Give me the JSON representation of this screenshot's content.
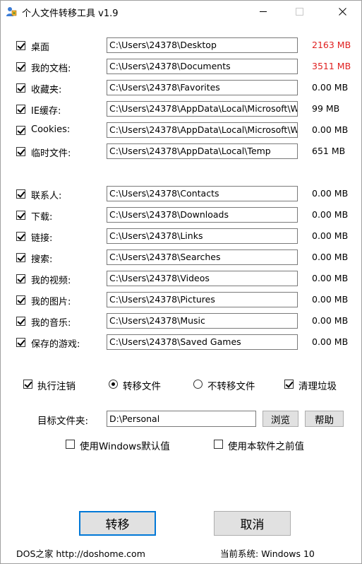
{
  "window": {
    "title": "个人文件转移工具 v1.9"
  },
  "folders_group1": [
    {
      "label": "桌面",
      "path": "C:\\Users\\24378\\Desktop",
      "size": "2163 MB",
      "checked": true,
      "highlight": true
    },
    {
      "label": "我的文档:",
      "path": "C:\\Users\\24378\\Documents",
      "size": "3511 MB",
      "checked": true,
      "highlight": true
    },
    {
      "label": "收藏夹:",
      "path": "C:\\Users\\24378\\Favorites",
      "size": "0.00 MB",
      "checked": true,
      "highlight": false
    },
    {
      "label": "IE缓存:",
      "path": "C:\\Users\\24378\\AppData\\Local\\Microsoft\\W",
      "size": "99 MB",
      "checked": true,
      "highlight": false
    },
    {
      "label": "Cookies:",
      "path": "C:\\Users\\24378\\AppData\\Local\\Microsoft\\W",
      "size": "0.00 MB",
      "checked": true,
      "highlight": false
    },
    {
      "label": "临时文件:",
      "path": "C:\\Users\\24378\\AppData\\Local\\Temp",
      "size": "651 MB",
      "checked": true,
      "highlight": false
    }
  ],
  "folders_group2": [
    {
      "label": "联系人:",
      "path": "C:\\Users\\24378\\Contacts",
      "size": "0.00 MB",
      "checked": true,
      "highlight": false
    },
    {
      "label": "下载:",
      "path": "C:\\Users\\24378\\Downloads",
      "size": "0.00 MB",
      "checked": true,
      "highlight": false
    },
    {
      "label": "链接:",
      "path": "C:\\Users\\24378\\Links",
      "size": "0.00 MB",
      "checked": true,
      "highlight": false
    },
    {
      "label": "搜索:",
      "path": "C:\\Users\\24378\\Searches",
      "size": "0.00 MB",
      "checked": true,
      "highlight": false
    },
    {
      "label": "我的视频:",
      "path": "C:\\Users\\24378\\Videos",
      "size": "0.00 MB",
      "checked": true,
      "highlight": false
    },
    {
      "label": "我的图片:",
      "path": "C:\\Users\\24378\\Pictures",
      "size": "0.00 MB",
      "checked": true,
      "highlight": false
    },
    {
      "label": "我的音乐:",
      "path": "C:\\Users\\24378\\Music",
      "size": "0.00 MB",
      "checked": true,
      "highlight": false
    },
    {
      "label": "保存的游戏:",
      "path": "C:\\Users\\24378\\Saved Games",
      "size": "0.00 MB",
      "checked": true,
      "highlight": false
    }
  ],
  "options": {
    "logoff": {
      "label": "执行注销",
      "checked": true
    },
    "transfer_files": {
      "label": "转移文件",
      "selected": true
    },
    "no_transfer_files": {
      "label": "不转移文件",
      "selected": false
    },
    "clean_junk": {
      "label": "清理垃圾",
      "checked": true
    }
  },
  "target": {
    "label": "目标文件夹:",
    "value": "D:\\Personal",
    "browse_label": "浏览",
    "help_label": "帮助"
  },
  "defaults": {
    "windows_default": {
      "label": "使用Windows默认值",
      "checked": false
    },
    "previous_value": {
      "label": "使用本软件之前值",
      "checked": false
    }
  },
  "buttons": {
    "transfer": "转移",
    "cancel": "取消"
  },
  "footer": {
    "site": "DOS之家 http://doshome.com",
    "system_label": "当前系统:",
    "system_value": "Windows 10"
  },
  "colors": {
    "size_highlight": "#e02020",
    "focus_border": "#0078d7"
  }
}
